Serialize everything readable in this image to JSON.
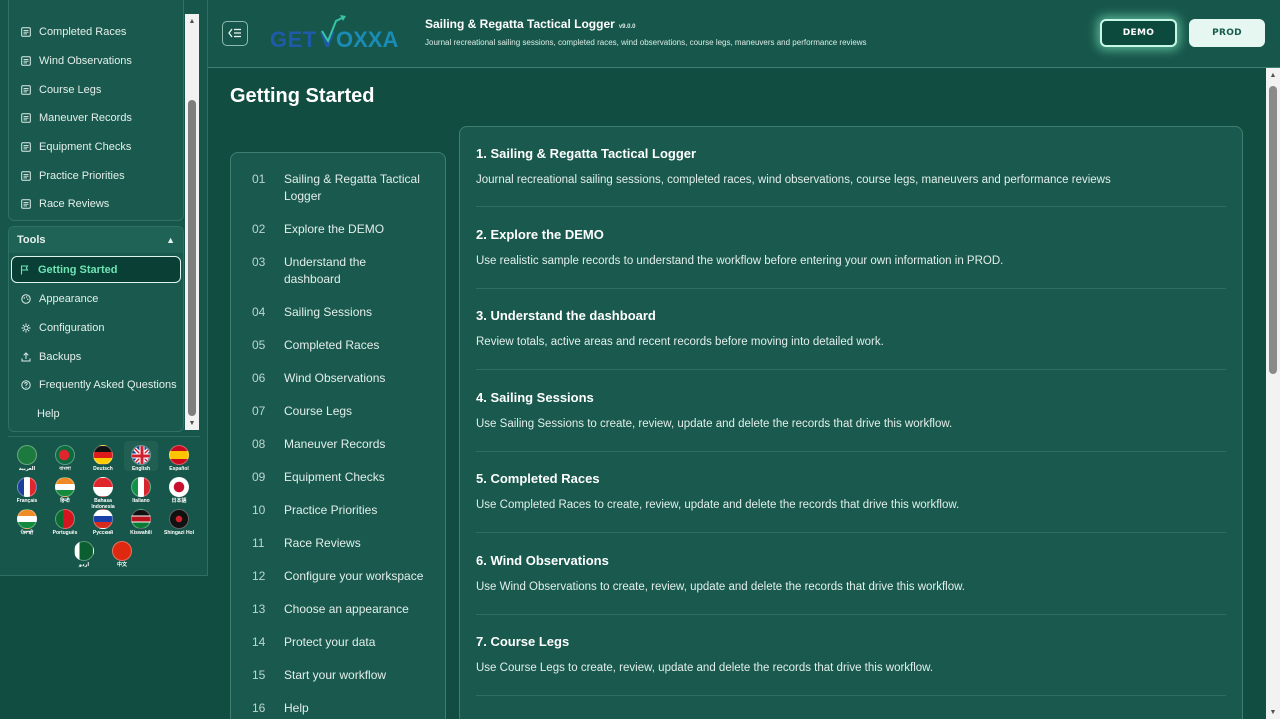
{
  "sidebar": {
    "records_items": [
      {
        "label": "Completed Races",
        "icon": "list-icon"
      },
      {
        "label": "Wind Observations",
        "icon": "list-icon"
      },
      {
        "label": "Course Legs",
        "icon": "list-icon"
      },
      {
        "label": "Maneuver Records",
        "icon": "list-icon"
      },
      {
        "label": "Equipment Checks",
        "icon": "list-icon"
      },
      {
        "label": "Practice Priorities",
        "icon": "list-icon"
      },
      {
        "label": "Race Reviews",
        "icon": "list-icon"
      }
    ],
    "tools": {
      "title": "Tools",
      "caret": "▲",
      "items": [
        {
          "label": "Getting Started",
          "icon": "flag-icon",
          "active": true
        },
        {
          "label": "Appearance",
          "icon": "palette-icon"
        },
        {
          "label": "Configuration",
          "icon": "gear-icon"
        },
        {
          "label": "Backups",
          "icon": "upload-icon"
        },
        {
          "label": "Frequently Asked Questions",
          "icon": "help-circle-icon"
        },
        {
          "label": "Help",
          "icon": ""
        }
      ]
    },
    "languages": [
      {
        "name": "العربية"
      },
      {
        "name": "বাংলা"
      },
      {
        "name": "Deutsch"
      },
      {
        "name": "English",
        "selected": true
      },
      {
        "name": "Español"
      },
      {
        "name": "Français"
      },
      {
        "name": "हिन्दी"
      },
      {
        "name": "Bahasa Indonesia"
      },
      {
        "name": "Italiano"
      },
      {
        "name": "日本語"
      },
      {
        "name": "ਪੰਜਾਬੀ"
      },
      {
        "name": "Português"
      },
      {
        "name": "Русский"
      },
      {
        "name": "Kiswahili"
      },
      {
        "name": "Shingazi Hol"
      },
      {
        "name": "اردو"
      },
      {
        "name": "中文"
      }
    ]
  },
  "header": {
    "logo_text": "GETVOXXA",
    "app_title": "Sailing & Regatta Tactical Logger",
    "version": "v9.0.0",
    "subtitle": "Journal recreational sailing sessions, completed races, wind observations, course legs, maneuvers and performance reviews",
    "demo_label": "DEMO",
    "prod_label": "PROD"
  },
  "main": {
    "page_title": "Getting Started",
    "toc": [
      {
        "num": "01",
        "label": "Sailing & Regatta Tactical Logger"
      },
      {
        "num": "02",
        "label": "Explore the DEMO"
      },
      {
        "num": "03",
        "label": "Understand the dashboard"
      },
      {
        "num": "04",
        "label": "Sailing Sessions"
      },
      {
        "num": "05",
        "label": "Completed Races"
      },
      {
        "num": "06",
        "label": "Wind Observations"
      },
      {
        "num": "07",
        "label": "Course Legs"
      },
      {
        "num": "08",
        "label": "Maneuver Records"
      },
      {
        "num": "09",
        "label": "Equipment Checks"
      },
      {
        "num": "10",
        "label": "Practice Priorities"
      },
      {
        "num": "11",
        "label": "Race Reviews"
      },
      {
        "num": "12",
        "label": "Configure your workspace"
      },
      {
        "num": "13",
        "label": "Choose an appearance"
      },
      {
        "num": "14",
        "label": "Protect your data"
      },
      {
        "num": "15",
        "label": "Start your workflow"
      },
      {
        "num": "16",
        "label": "Help"
      }
    ],
    "sections": [
      {
        "title": "1. Sailing & Regatta Tactical Logger",
        "body": "Journal recreational sailing sessions, completed races, wind observations, course legs, maneuvers and performance reviews"
      },
      {
        "title": "2. Explore the DEMO",
        "body": "Use realistic sample records to understand the workflow before entering your own information in PROD."
      },
      {
        "title": "3. Understand the dashboard",
        "body": "Review totals, active areas and recent records before moving into detailed work."
      },
      {
        "title": "4. Sailing Sessions",
        "body": "Use Sailing Sessions to create, review, update and delete the records that drive this workflow."
      },
      {
        "title": "5. Completed Races",
        "body": "Use Completed Races to create, review, update and delete the records that drive this workflow."
      },
      {
        "title": "6. Wind Observations",
        "body": "Use Wind Observations to create, review, update and delete the records that drive this workflow."
      },
      {
        "title": "7. Course Legs",
        "body": "Use Course Legs to create, review, update and delete the records that drive this workflow."
      }
    ]
  },
  "colors": {
    "background": "#124d42",
    "panel": "#1a5a4e",
    "accent": "#6de4b4"
  }
}
